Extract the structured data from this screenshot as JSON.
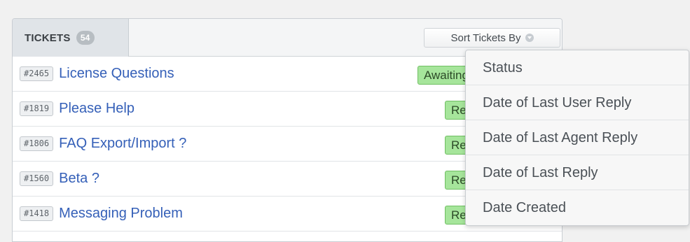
{
  "header": {
    "title": "TICKETS",
    "count": "54",
    "sort_label": "Sort Tickets By"
  },
  "tickets": [
    {
      "id": "#2465",
      "title": "License Questions",
      "status": "Awaiting"
    },
    {
      "id": "#1819",
      "title": "Please Help",
      "status": "Re"
    },
    {
      "id": "#1806",
      "title": "FAQ Export/Import ?",
      "status": "Re"
    },
    {
      "id": "#1560",
      "title": "Beta ?",
      "status": "Re"
    },
    {
      "id": "#1418",
      "title": "Messaging Problem",
      "status": "Resolved"
    }
  ],
  "sort_menu": {
    "items": [
      "Status",
      "Date of Last User Reply",
      "Date of Last Agent Reply",
      "Date of Last Reply",
      "Date Created"
    ]
  },
  "colors": {
    "status_green": "#a6e59b",
    "link_blue": "#3560b8"
  },
  "icons": {
    "sort_chevron": "chevron-down-icon"
  }
}
